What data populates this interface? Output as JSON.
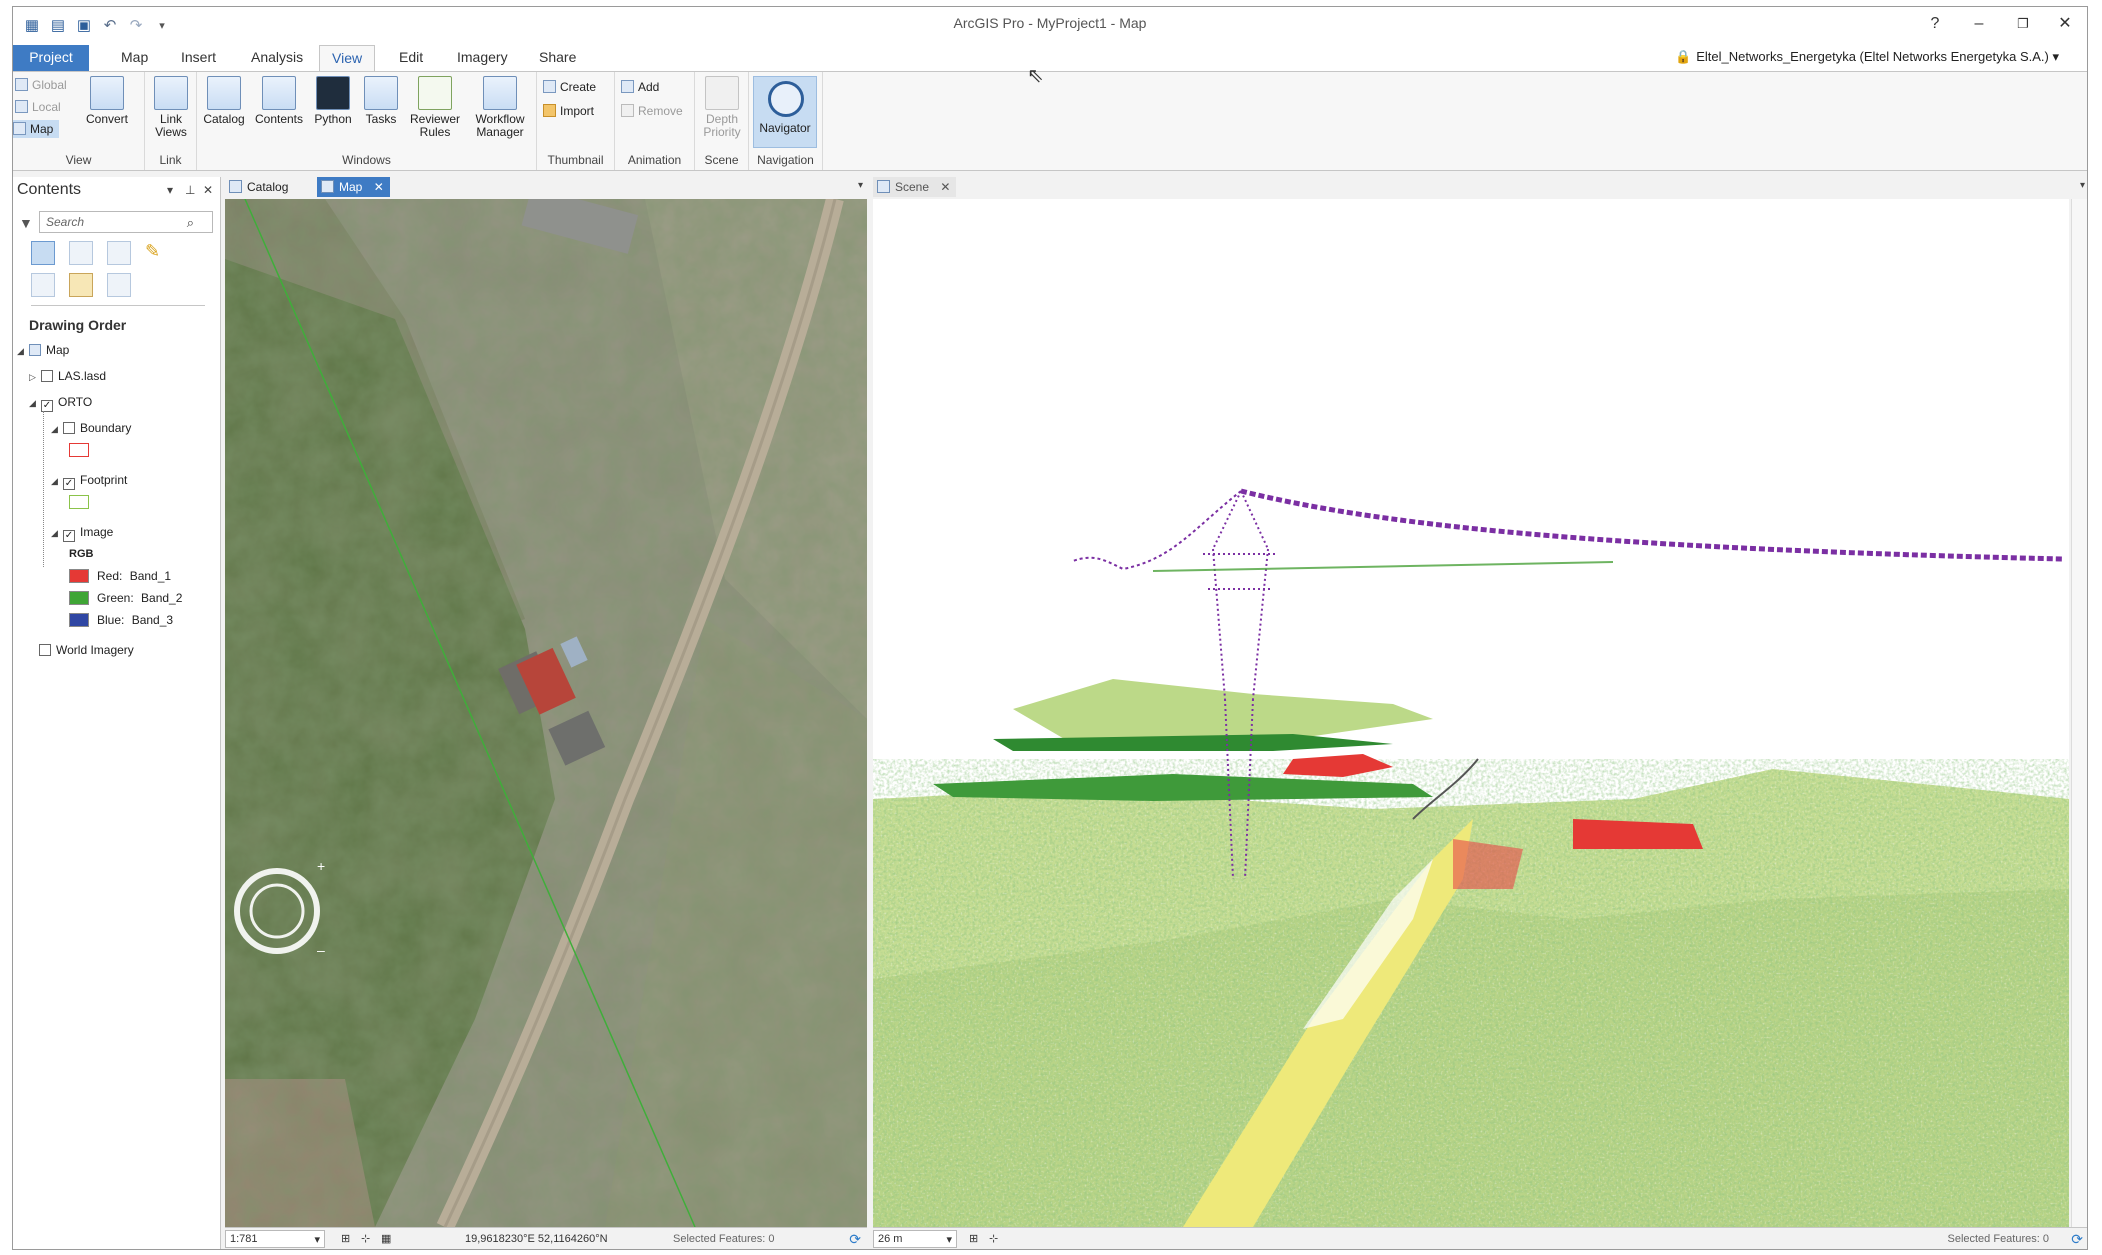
{
  "window": {
    "title": "ArcGIS Pro - MyProject1 - Map",
    "help": "?",
    "minimize": "–",
    "maximize": "❐",
    "close": "✕"
  },
  "quick_access": {
    "icons": [
      "new-project-icon",
      "open-icon",
      "save-icon",
      "undo-icon",
      "redo-icon",
      "customize-icon"
    ],
    "undo": "↶",
    "redo": "↷",
    "customize": "▾"
  },
  "ribbon_tabs": [
    "Project",
    "Map",
    "Insert",
    "Analysis",
    "View",
    "Edit",
    "Imagery",
    "Share"
  ],
  "active_tab": "View",
  "user": {
    "name": "Eltel_Networks_Energetyka (Eltel Networks Energetyka S.A.)",
    "caret": "▾"
  },
  "ribbon": {
    "view_group": {
      "label": "View",
      "global": "Global",
      "local": "Local",
      "map": "Map",
      "convert": "Convert"
    },
    "link_group": {
      "label": "Link",
      "link_views": "Link",
      "link_views2": "Views"
    },
    "windows_group": {
      "label": "Windows",
      "catalog": "Catalog",
      "contents": "Contents",
      "python": "Python",
      "tasks": "Tasks",
      "reviewer_rules": "Reviewer",
      "reviewer_rules2": "Rules",
      "workflow_manager": "Workflow",
      "workflow_manager2": "Manager"
    },
    "thumbnail_group": {
      "label": "Thumbnail",
      "create": "Create",
      "import": "Import"
    },
    "animation_group": {
      "label": "Animation",
      "add": "Add",
      "remove": "Remove"
    },
    "scene_group": {
      "label": "Scene",
      "depth": "Depth",
      "priority": "Priority"
    },
    "navigation_group": {
      "label": "Navigation",
      "navigator": "Navigator"
    }
  },
  "contents": {
    "title": "Contents",
    "search_placeholder": "Search",
    "pane_controls": {
      "menu": "▾",
      "pin": "⊥",
      "close": "✕"
    },
    "drawing_order": "Drawing Order",
    "layers": {
      "map": "Map",
      "las": "LAS.lasd",
      "orto": "ORTO",
      "boundary": "Boundary",
      "footprint": "Footprint",
      "image": "Image",
      "rgb": "RGB",
      "red": "Red:",
      "red_band": "Band_1",
      "green": "Green:",
      "green_band": "Band_2",
      "blue": "Blue:",
      "blue_band": "Band_3",
      "world_imagery": "World Imagery"
    },
    "checked": {
      "las": false,
      "orto": true,
      "boundary": false,
      "footprint": true,
      "image": true,
      "world_imagery": false
    },
    "colors": {
      "boundary": "#e53935",
      "footprint": "#8bc34a",
      "red": "#e53935",
      "green": "#3fa535",
      "blue": "#2f46a3"
    }
  },
  "map_pane": {
    "tabs": [
      {
        "label": "Catalog",
        "close": ""
      },
      {
        "label": "Map",
        "close": "✕"
      }
    ],
    "scale": "1:781",
    "coordinates": "19,9618230°E 52,1164260°N",
    "selected_features": "Selected Features: 0"
  },
  "scene_pane": {
    "tab": "Scene",
    "tab_close": "✕",
    "scale": "26 m",
    "selected_features": "Selected Features: 0"
  }
}
